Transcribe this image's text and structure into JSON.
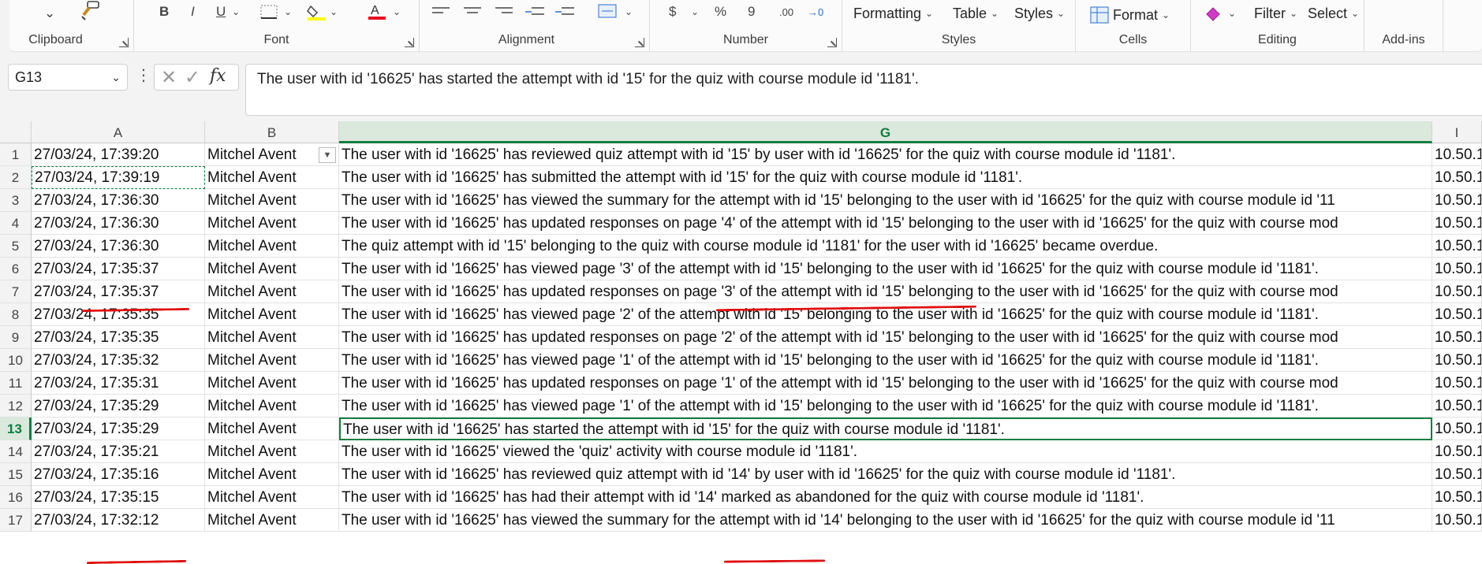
{
  "ribbon": {
    "groups": {
      "clipboard": "Clipboard",
      "font": "Font",
      "alignment": "Alignment",
      "number": "Number",
      "styles": "Styles",
      "cells": "Cells",
      "editing": "Editing",
      "addins": "Add-ins"
    },
    "commands": {
      "formatting": "Formatting",
      "table": "Table",
      "styles": "Styles",
      "format": "Format",
      "filter": "Filter",
      "select": "Select"
    },
    "number_tools": {
      "percent": "%",
      "comma": "9",
      "increase_decimal": ".00",
      "decrease_decimal": "→0"
    },
    "colors": {
      "accent": "#107c41",
      "highlight": "#ffff00",
      "font_color": "#e81123"
    }
  },
  "formula_bar": {
    "name_box": "G13",
    "fx": "fx",
    "formula": "The user with id '16625' has started the attempt with id '15' for the quiz with course module id '1181'."
  },
  "grid": {
    "column_headers": [
      "A",
      "B",
      "G",
      "I"
    ],
    "active_column": "G",
    "active_row": "13",
    "rows": [
      {
        "num": "1",
        "a": "27/03/24, 17:39:20",
        "b": "Mitchel Avent",
        "g": "The user with id '16625' has reviewed quiz attempt with id '15' by user with id '16625' for the quiz with course module id '1181'.",
        "i": "10.50.1"
      },
      {
        "num": "2",
        "a": "27/03/24, 17:39:19",
        "b": "Mitchel Avent",
        "g": "The user with id '16625' has submitted the attempt with id '15' for the quiz with course module id '1181'.",
        "i": "10.50.1"
      },
      {
        "num": "3",
        "a": "27/03/24, 17:36:30",
        "b": "Mitchel Avent",
        "g": "The user with id '16625' has viewed the summary for the attempt with id '15' belonging to the user with id '16625' for the quiz with course module id '11",
        "i": "10.50.1"
      },
      {
        "num": "4",
        "a": "27/03/24, 17:36:30",
        "b": "Mitchel Avent",
        "g": "The user with id '16625' has updated responses on page '4' of the attempt with id '15' belonging to the user with id '16625' for the quiz with course mod",
        "i": "10.50.1"
      },
      {
        "num": "5",
        "a": "27/03/24, 17:36:30",
        "b": "Mitchel Avent",
        "g": "The quiz attempt with id '15' belonging to the quiz with course module id '1181' for the user with id '16625' became overdue.",
        "i": "10.50.1"
      },
      {
        "num": "6",
        "a": "27/03/24, 17:35:37",
        "b": "Mitchel Avent",
        "g": "The user with id '16625' has viewed page '3' of the attempt with id '15' belonging to the user with id '16625' for the quiz with course module id '1181'.",
        "i": "10.50.1"
      },
      {
        "num": "7",
        "a": "27/03/24, 17:35:37",
        "b": "Mitchel Avent",
        "g": "The user with id '16625' has updated responses on page '3' of the attempt with id '15' belonging to the user with id '16625' for the quiz with course mod",
        "i": "10.50.1"
      },
      {
        "num": "8",
        "a": "27/03/24, 17:35:35",
        "b": "Mitchel Avent",
        "g": "The user with id '16625' has viewed page '2' of the attempt with id '15' belonging to the user with id '16625' for the quiz with course module id '1181'.",
        "i": "10.50.1"
      },
      {
        "num": "9",
        "a": "27/03/24, 17:35:35",
        "b": "Mitchel Avent",
        "g": "The user with id '16625' has updated responses on page '2' of the attempt with id '15' belonging to the user with id '16625' for the quiz with course mod",
        "i": "10.50.1"
      },
      {
        "num": "10",
        "a": "27/03/24, 17:35:32",
        "b": "Mitchel Avent",
        "g": "The user with id '16625' has viewed page '1' of the attempt with id '15' belonging to the user with id '16625' for the quiz with course module id '1181'.",
        "i": "10.50.1"
      },
      {
        "num": "11",
        "a": "27/03/24, 17:35:31",
        "b": "Mitchel Avent",
        "g": "The user with id '16625' has updated responses on page '1' of the attempt with id '15' belonging to the user with id '16625' for the quiz with course mod",
        "i": "10.50.1"
      },
      {
        "num": "12",
        "a": "27/03/24, 17:35:29",
        "b": "Mitchel Avent",
        "g": "The user with id '16625' has viewed page '1' of the attempt with id '15' belonging to the user with id '16625' for the quiz with course module id '1181'.",
        "i": "10.50.1"
      },
      {
        "num": "13",
        "a": "27/03/24, 17:35:29",
        "b": "Mitchel Avent",
        "g": "The user with id '16625' has started the attempt with id '15' for the quiz with course module id '1181'.",
        "i": "10.50.1"
      },
      {
        "num": "14",
        "a": "27/03/24, 17:35:21",
        "b": "Mitchel Avent",
        "g": "The user with id '16625' viewed the 'quiz' activity with course module id '1181'.",
        "i": "10.50.1"
      },
      {
        "num": "15",
        "a": "27/03/24, 17:35:16",
        "b": "Mitchel Avent",
        "g": "The user with id '16625' has reviewed quiz attempt with id '14' by user with id '16625' for the quiz with course module id '1181'.",
        "i": "10.50.1"
      },
      {
        "num": "16",
        "a": "27/03/24, 17:35:15",
        "b": "Mitchel Avent",
        "g": "The user with id '16625' has had their attempt with id '14' marked as abandoned for the quiz with course module id '1181'.",
        "i": "10.50.1"
      },
      {
        "num": "17",
        "a": "27/03/24, 17:32:12",
        "b": "Mitchel Avent",
        "g": "The user with id '16625' has viewed the summary for the attempt with id '14' belonging to the user with id '16625' for the quiz with course module id '11",
        "i": "10.50.1"
      }
    ]
  }
}
